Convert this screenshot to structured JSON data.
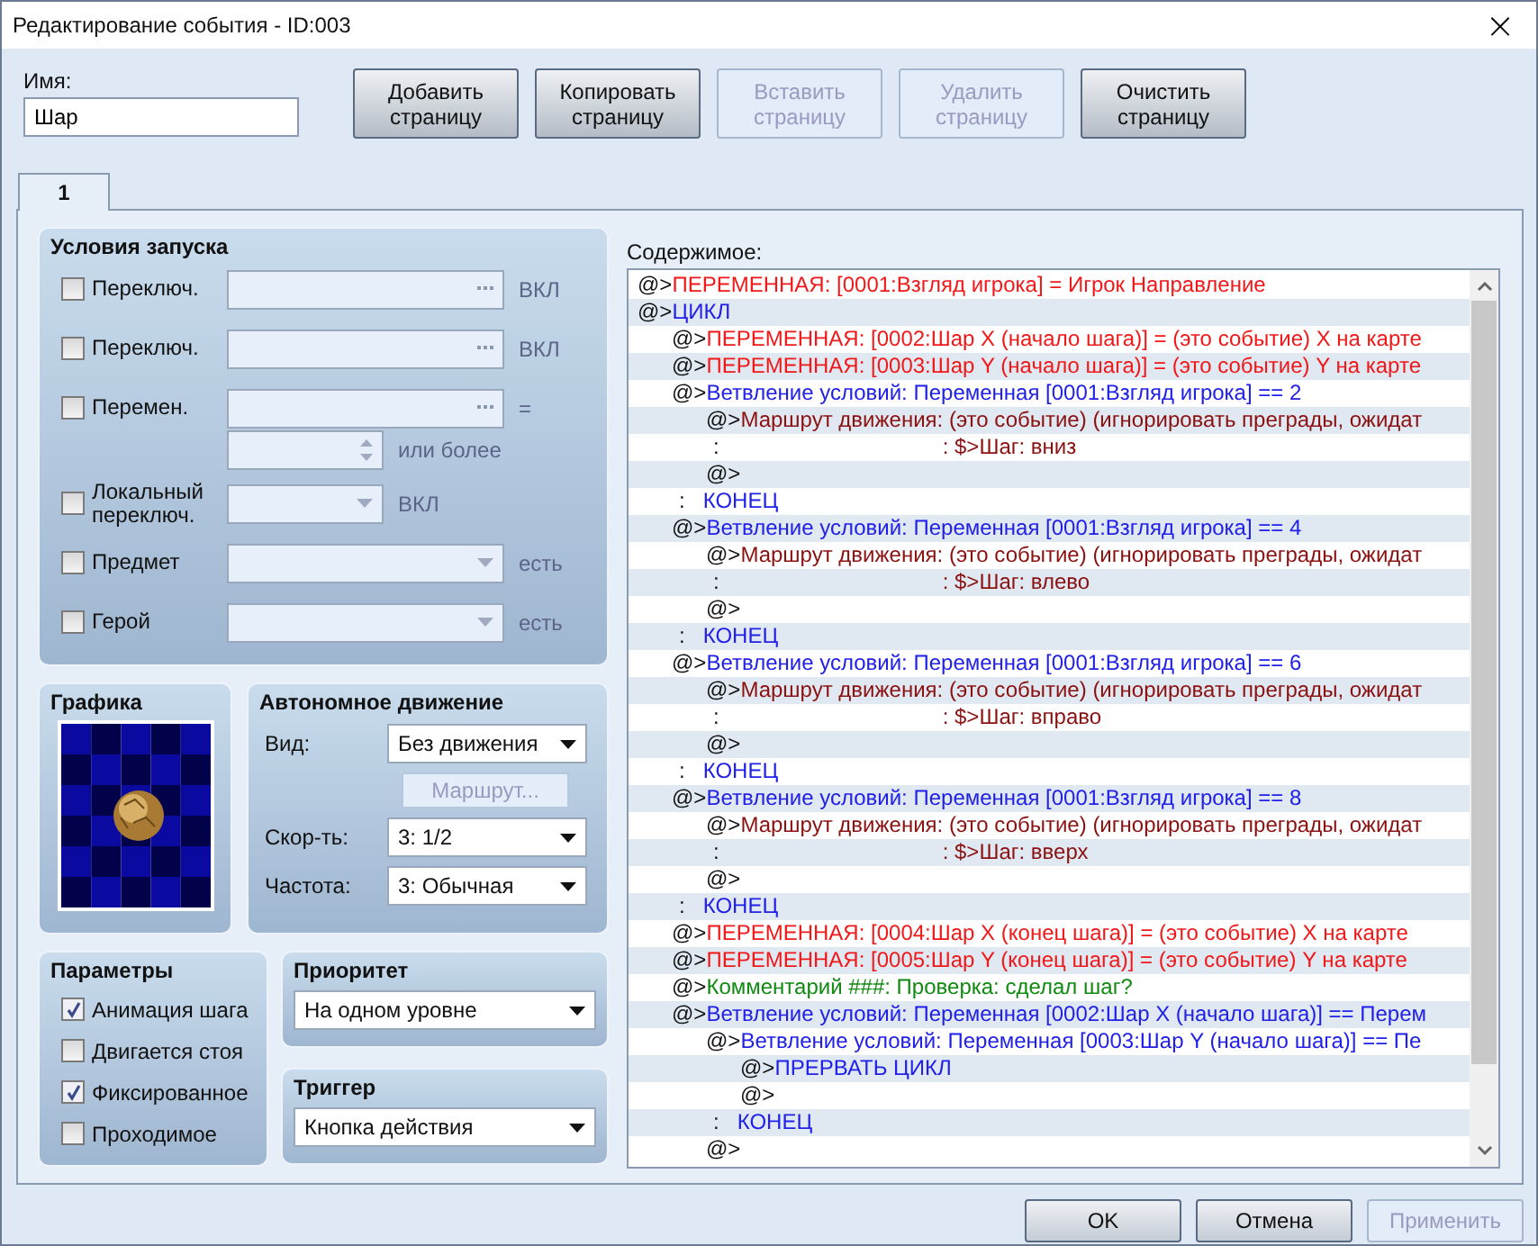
{
  "window": {
    "title": "Редактирование события - ID:003",
    "close": "×"
  },
  "name_field": {
    "label": "Имя:",
    "value": "Шар"
  },
  "page_buttons": [
    {
      "label": "Добавить страницу",
      "disabled": false
    },
    {
      "label": "Копировать страницу",
      "disabled": false
    },
    {
      "label": "Вставить страницу",
      "disabled": true
    },
    {
      "label": "Удалить страницу",
      "disabled": true
    },
    {
      "label": "Очистить страницу",
      "disabled": false
    }
  ],
  "tabs": [
    {
      "label": "1",
      "selected": true
    }
  ],
  "conditions": {
    "title": "Условия запуска",
    "rows": [
      {
        "kind": "picker",
        "label": "Переключ.",
        "checked": false,
        "suffix": "ВКЛ"
      },
      {
        "kind": "picker",
        "label": "Переключ.",
        "checked": false,
        "suffix": "ВКЛ"
      },
      {
        "kind": "picker",
        "label": "Перемен.",
        "checked": false,
        "suffix": "="
      },
      {
        "kind": "spin",
        "suffix": "или более"
      },
      {
        "kind": "short",
        "label": "Локальный переключ.",
        "checked": false,
        "suffix": "ВКЛ"
      },
      {
        "kind": "dropdown",
        "label": "Предмет",
        "checked": false,
        "suffix": "есть"
      },
      {
        "kind": "dropdown",
        "label": "Герой",
        "checked": false,
        "suffix": "есть"
      }
    ]
  },
  "graphic": {
    "title": "Графика"
  },
  "autonomous": {
    "title": "Автономное движение",
    "type_label": "Вид:",
    "type_value": "Без движения",
    "route_button": {
      "label": "Маршрут...",
      "disabled": true
    },
    "speed_label": "Скор-ть:",
    "speed_value": "3: 1/2",
    "freq_label": "Частота:",
    "freq_value": "3: Обычная"
  },
  "options": {
    "title": "Параметры",
    "items": [
      {
        "label": "Анимация шага",
        "checked": true
      },
      {
        "label": "Двигается стоя",
        "checked": false
      },
      {
        "label": "Фиксированное",
        "checked": true
      },
      {
        "label": "Проходимое",
        "checked": false
      }
    ]
  },
  "priority": {
    "title": "Приоритет",
    "value": "На одном уровне"
  },
  "trigger": {
    "title": "Триггер",
    "value": "Кнопка действия"
  },
  "contents": {
    "label": "Содержимое:",
    "lines": [
      {
        "kind": "variable",
        "prefix": "@>",
        "text": "ПЕРЕМЕННАЯ: [0001:Взгляд игрока] = Игрок Направление"
      },
      {
        "kind": "flow",
        "prefix": "@>",
        "text": "ЦИКЛ",
        "children": [
          {
            "kind": "variable",
            "prefix": "@>",
            "text": "ПЕРЕМЕННАЯ: [0002:Шар X (начало шага)] = (это событие) X на карте"
          },
          {
            "kind": "variable",
            "prefix": "@>",
            "text": "ПЕРЕМЕННАЯ: [0003:Шар Y (начало шага)] = (это событие) Y на карте"
          },
          {
            "kind": "flow",
            "prefix": "@>",
            "text": "Ветвление условий: Переменная [0001:Взгляд игрока] == 2",
            "children": [
              {
                "kind": "move",
                "prefix": "@>",
                "text": "Маршрут движения: (это событие) (игнорировать преграды, ожидат"
              },
              {
                "kind": "step",
                "prefix": ":",
                "text": ": $>Шаг: вниз"
              },
              {
                "kind": "empty",
                "prefix": "@>"
              }
            ]
          },
          {
            "kind": "end",
            "prefix": ":",
            "text": "КОНЕЦ"
          },
          {
            "kind": "flow",
            "prefix": "@>",
            "text": "Ветвление условий: Переменная [0001:Взгляд игрока] == 4",
            "children": [
              {
                "kind": "move",
                "prefix": "@>",
                "text": "Маршрут движения: (это событие) (игнорировать преграды, ожидат"
              },
              {
                "kind": "step",
                "prefix": ":",
                "text": ": $>Шаг: влево"
              },
              {
                "kind": "empty",
                "prefix": "@>"
              }
            ]
          },
          {
            "kind": "end",
            "prefix": ":",
            "text": "КОНЕЦ"
          },
          {
            "kind": "flow",
            "prefix": "@>",
            "text": "Ветвление условий: Переменная [0001:Взгляд игрока] == 6",
            "children": [
              {
                "kind": "move",
                "prefix": "@>",
                "text": "Маршрут движения: (это событие) (игнорировать преграды, ожидат"
              },
              {
                "kind": "step",
                "prefix": ":",
                "text": ": $>Шаг: вправо"
              },
              {
                "kind": "empty",
                "prefix": "@>"
              }
            ]
          },
          {
            "kind": "end",
            "prefix": ":",
            "text": "КОНЕЦ"
          },
          {
            "kind": "flow",
            "prefix": "@>",
            "text": "Ветвление условий: Переменная [0001:Взгляд игрока] == 8",
            "children": [
              {
                "kind": "move",
                "prefix": "@>",
                "text": "Маршрут движения: (это событие) (игнорировать преграды, ожидат"
              },
              {
                "kind": "step",
                "prefix": ":",
                "text": ": $>Шаг: вверх"
              },
              {
                "kind": "empty",
                "prefix": "@>"
              }
            ]
          },
          {
            "kind": "end",
            "prefix": ":",
            "text": "КОНЕЦ"
          },
          {
            "kind": "variable",
            "prefix": "@>",
            "text": "ПЕРЕМЕННАЯ: [0004:Шар X (конец шага)] = (это событие) X на карте"
          },
          {
            "kind": "variable",
            "prefix": "@>",
            "text": "ПЕРЕМЕННАЯ: [0005:Шар Y (конец шага)] = (это событие) Y на карте"
          },
          {
            "kind": "comment",
            "prefix": "@>",
            "text": "Комментарий ###: Проверка: сделал шаг?"
          },
          {
            "kind": "flow",
            "prefix": "@>",
            "text": "Ветвление условий: Переменная [0002:Шар X (начало шага)] == Перем",
            "children": [
              {
                "kind": "flow",
                "prefix": "@>",
                "text": "Ветвление условий: Переменная [0003:Шар Y (начало шага)] == Пе",
                "children": [
                  {
                    "kind": "flow",
                    "prefix": "@>",
                    "text": "ПРЕРВАТЬ ЦИКЛ"
                  },
                  {
                    "kind": "empty",
                    "prefix": "@>"
                  }
                ]
              },
              {
                "kind": "end",
                "prefix": ":",
                "text": "КОНЕЦ"
              },
              {
                "kind": "empty",
                "prefix": "@>"
              }
            ]
          }
        ]
      }
    ]
  },
  "footer_buttons": [
    {
      "label": "OK",
      "disabled": false
    },
    {
      "label": "Отмена",
      "disabled": false
    },
    {
      "label": "Применить",
      "disabled": true
    }
  ]
}
